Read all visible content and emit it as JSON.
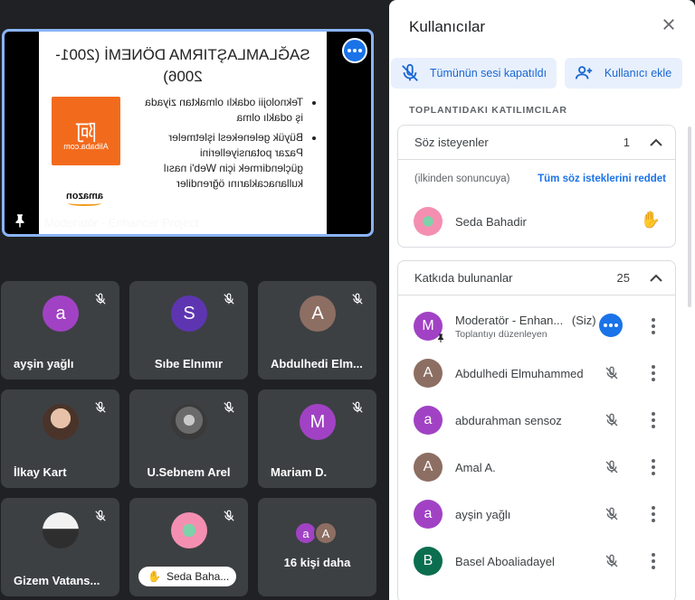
{
  "presentation": {
    "slide_title": "SAĞLAMLAŞTIRMA DÖNEMİ (2001-2006)",
    "bullets": [
      "Teknolojii odaklı olmaktan ziyada iş odaklı olma",
      "Büyük gelenekesl işletmeler Pazar potansiyellerini güçlendirmek için Web'i nasıl kullanacaklarını öğrendiler"
    ],
    "logo_text": "Alibaba.com",
    "logo_glyph": "阿",
    "amazon_text": "amazon",
    "presenter_label": "Moderatör - Enhancer Project"
  },
  "tiles": [
    {
      "name": "ayşin yağlı",
      "initial": "a",
      "color": "#a142c4"
    },
    {
      "name": "Sıbe Elnımır",
      "initial": "S",
      "color": "#5e35b1"
    },
    {
      "name": "Abdulhedi Elm...",
      "initial": "A",
      "color": "#8d6e63"
    },
    {
      "name": "İlkay Kart",
      "initial": "",
      "color": ""
    },
    {
      "name": "U.Sebnem Arel",
      "initial": "",
      "color": ""
    },
    {
      "name": "Mariam D.",
      "initial": "M",
      "color": "#a142c4"
    },
    {
      "name": "Gizem Vatans...",
      "initial": "",
      "color": ""
    },
    {
      "name": "Seda Baha...",
      "initial": "",
      "color": ""
    },
    {
      "name": "16 kişi daha",
      "initial": "",
      "color": ""
    }
  ],
  "more_avatars": [
    {
      "initial": "a",
      "color": "#a142c4"
    },
    {
      "initial": "A",
      "color": "#8d6e63"
    }
  ],
  "panel": {
    "title": "Kullanıcılar",
    "mute_all": "Tümünün sesi kapatıldı",
    "add_user": "Kullanıcı ekle",
    "section": "TOPLANTIDAKI KATILIMCILAR",
    "raise": {
      "title": "Söz isteyenler",
      "count": "1",
      "order": "(ilkinden sonuncuya)",
      "reject_all": "Tüm söz isteklerini reddet",
      "person": "Seda Bahadir"
    },
    "contrib": {
      "title": "Katkıda bulunanlar",
      "count": "25",
      "people": [
        {
          "name": "Moderatör - Enhan...",
          "tag": "(Siz)",
          "sub": "Toplantıyı düzenleyen",
          "initial": "M",
          "color": "#a142c4"
        },
        {
          "name": "Abdulhedi Elmuhammed",
          "initial": "A",
          "color": "#8d6e63"
        },
        {
          "name": "abdurahman sensoz",
          "initial": "a",
          "color": "#a142c4"
        },
        {
          "name": "Amal A.",
          "initial": "A",
          "color": "#8d6e63"
        },
        {
          "name": "ayşin yağlı",
          "initial": "a",
          "color": "#a142c4"
        },
        {
          "name": "Basel Aboaliadayel",
          "initial": "B",
          "color": "#0b6e4f"
        }
      ]
    }
  }
}
